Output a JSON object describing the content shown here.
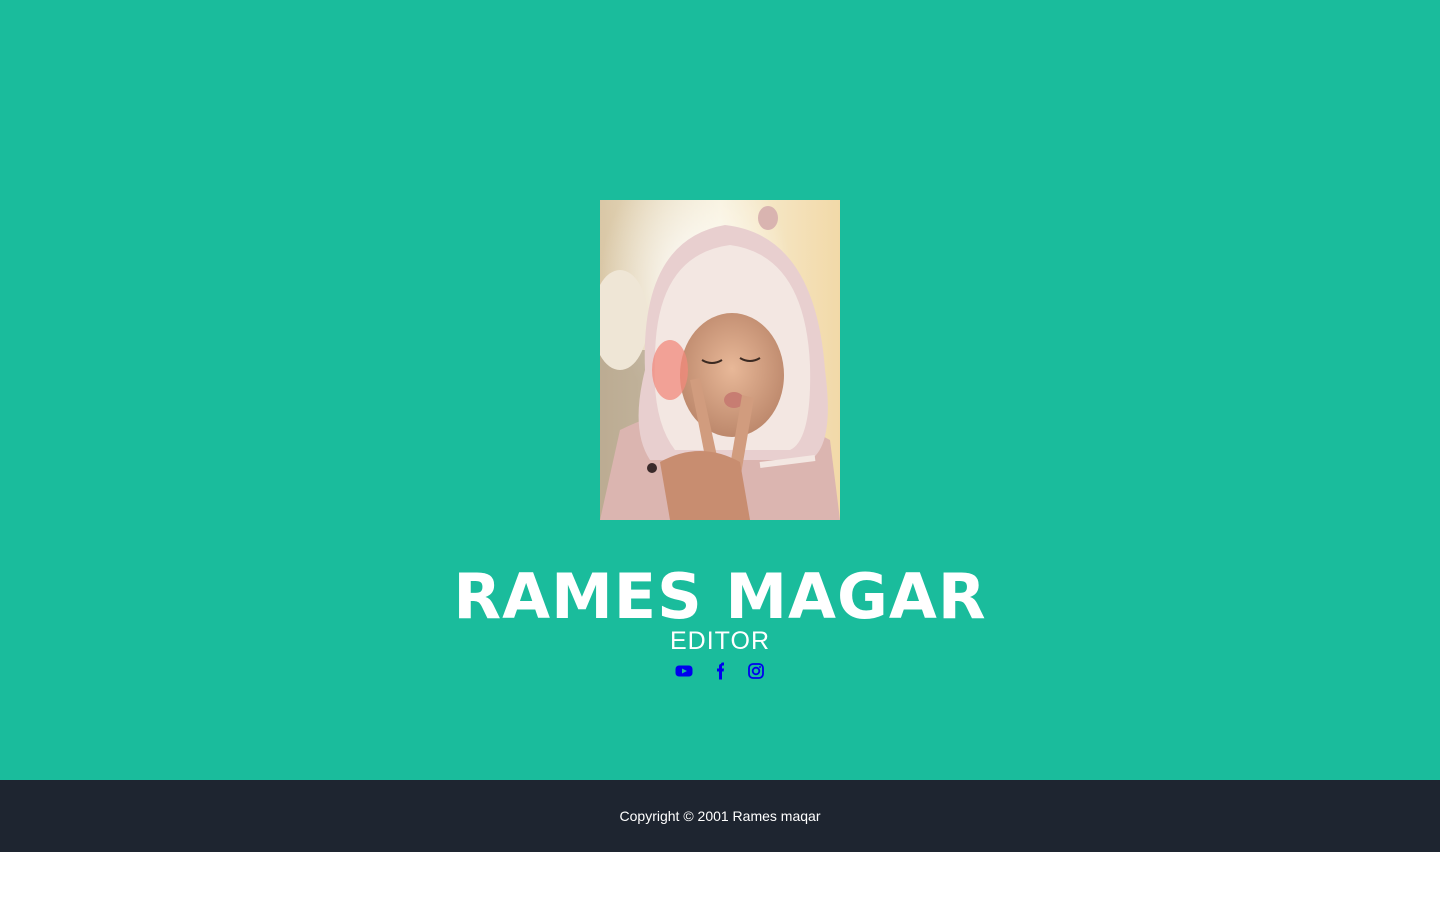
{
  "profile": {
    "name": "RAMES MAGAR",
    "role": "EDITOR",
    "photo_icon": "profile-photo"
  },
  "socials": [
    {
      "icon": "youtube-icon"
    },
    {
      "icon": "facebook-icon"
    },
    {
      "icon": "instagram-icon"
    }
  ],
  "footer": {
    "copyright": "Copyright © 2001 Rames maqar"
  },
  "colors": {
    "masthead_bg": "#1abc9c",
    "footer_bg": "#1e2530",
    "text": "#ffffff",
    "social_icon": "#0000ee"
  }
}
